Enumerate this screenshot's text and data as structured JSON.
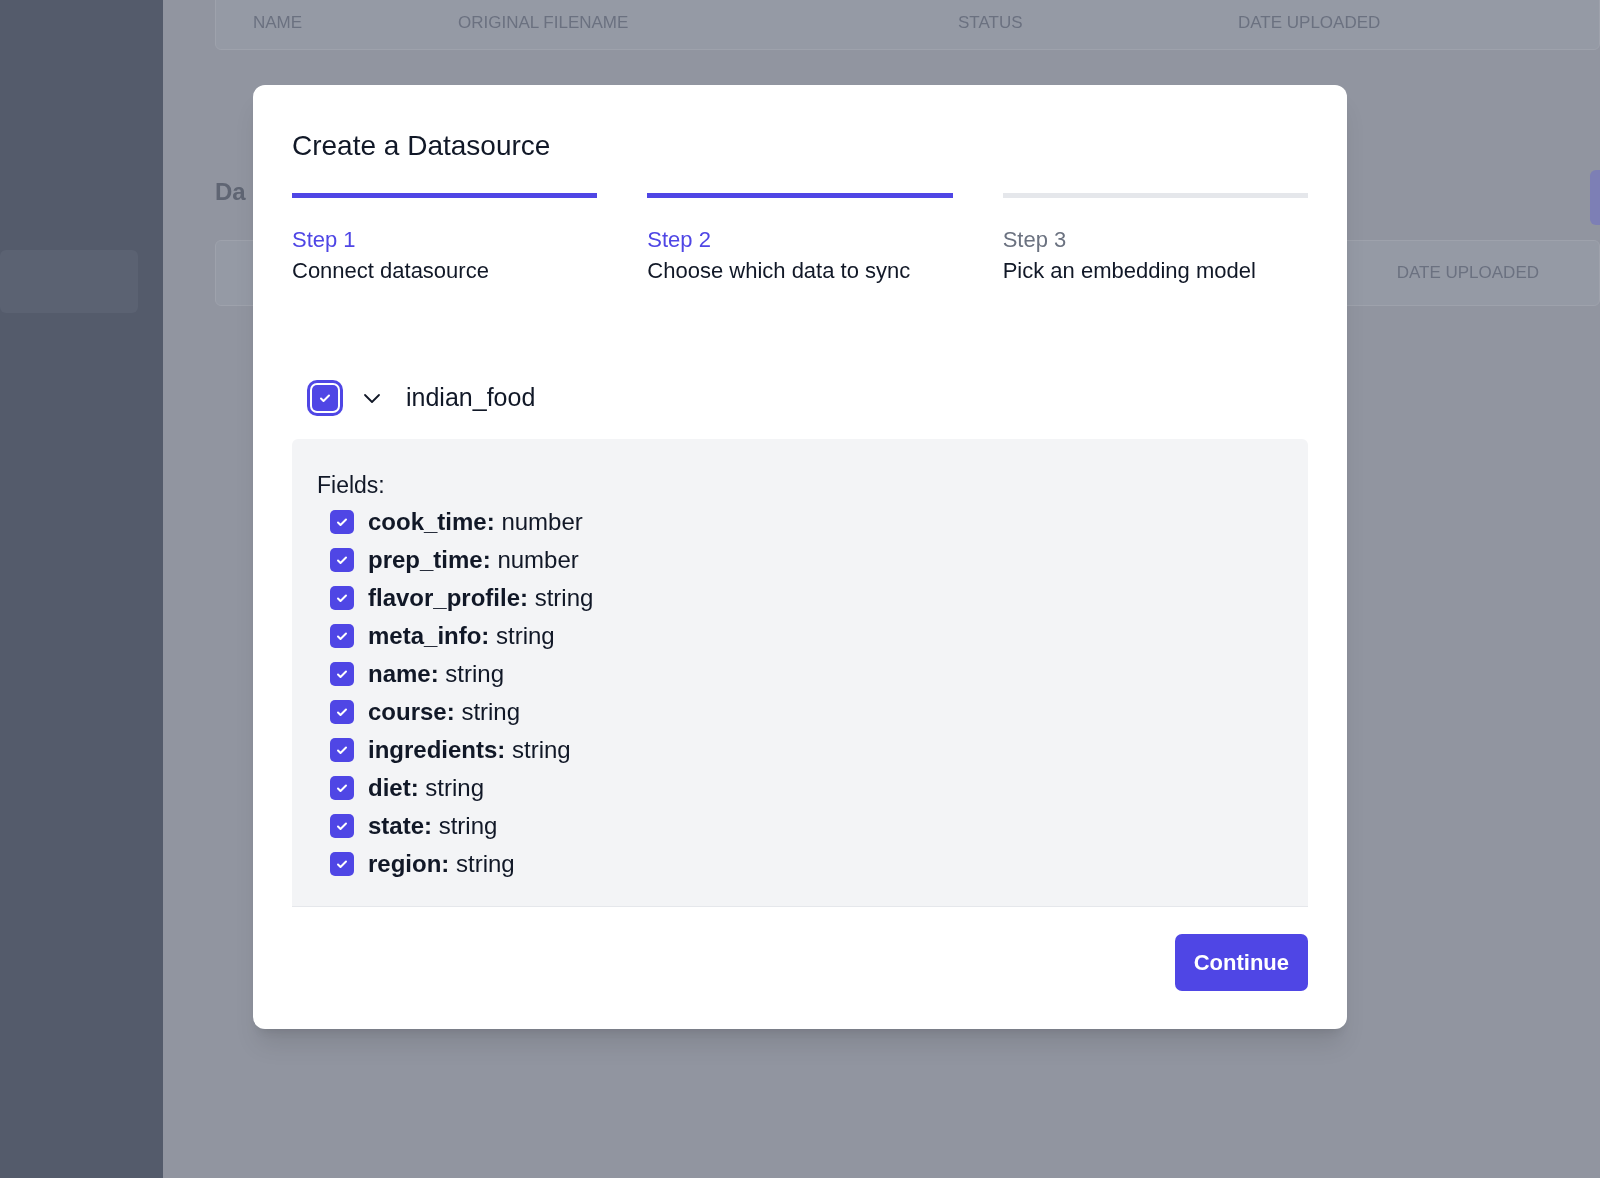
{
  "background": {
    "table_columns": [
      "NAME",
      "ORIGINAL FILENAME",
      "STATUS",
      "DATE UPLOADED"
    ],
    "section_heading": "Da",
    "second_table_columns": [
      "DATE UPLOADED"
    ]
  },
  "dialog": {
    "title": "Create a Datasource",
    "steps": [
      {
        "label": "Step 1",
        "title": "Connect datasource",
        "active": true
      },
      {
        "label": "Step 2",
        "title": "Choose which data to sync",
        "active": true
      },
      {
        "label": "Step 3",
        "title": "Pick an embedding model",
        "active": false
      }
    ],
    "datasource": {
      "name": "indian_food",
      "checked": true,
      "expanded": true,
      "fields_label": "Fields:",
      "fields": [
        {
          "name": "cook_time:",
          "type": "number",
          "checked": true
        },
        {
          "name": "prep_time:",
          "type": "number",
          "checked": true
        },
        {
          "name": "flavor_profile:",
          "type": "string",
          "checked": true
        },
        {
          "name": "meta_info:",
          "type": "string",
          "checked": true
        },
        {
          "name": "name:",
          "type": "string",
          "checked": true
        },
        {
          "name": "course:",
          "type": "string",
          "checked": true
        },
        {
          "name": "ingredients:",
          "type": "string",
          "checked": true
        },
        {
          "name": "diet:",
          "type": "string",
          "checked": true
        },
        {
          "name": "state:",
          "type": "string",
          "checked": true
        },
        {
          "name": "region:",
          "type": "string",
          "checked": true
        }
      ]
    },
    "button": "Continue"
  }
}
